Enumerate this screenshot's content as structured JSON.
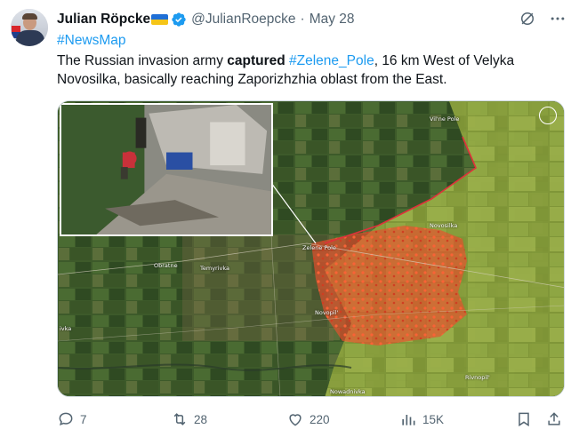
{
  "author": {
    "name": "Julian Röpcke",
    "handle": "@JulianRoepcke",
    "separator": "·",
    "date": "May 28"
  },
  "tweet": {
    "hashtag": "#NewsMap",
    "text_before": "The Russian invasion army ",
    "text_bold": "captured",
    "text_mid": " ",
    "text_link": "#Zelene_Pole",
    "text_after": ", 16 km West of Velyka Novosilka, basically reaching Zaporizhzhia oblast from the East."
  },
  "map": {
    "labels": {
      "zelene_pole": "Zelene Pole",
      "vilne_pole": "Vil'ne Pole",
      "novosilka": "Novosilka",
      "obratne": "Obratne",
      "temyrivka": "Temyrivka",
      "novopil": "Novopil'",
      "rivnopil": "Rivnopil'",
      "nowadnivka": "Nowadnivka",
      "ivka": "ivka"
    }
  },
  "actions": {
    "replies": "7",
    "reposts": "28",
    "likes": "220",
    "views": "15K"
  },
  "icons": {
    "verified": "verified-badge-icon",
    "grok": "grok-icon",
    "more": "more-icon",
    "reply": "reply-icon",
    "repost": "repost-icon",
    "like": "like-icon",
    "views": "views-icon",
    "bookmark": "bookmark-icon",
    "share": "share-icon"
  },
  "colors": {
    "link": "#1d9bf0",
    "muted": "#536471",
    "verified": "#1d9bf0",
    "occupied_area": "#e84a2a"
  }
}
